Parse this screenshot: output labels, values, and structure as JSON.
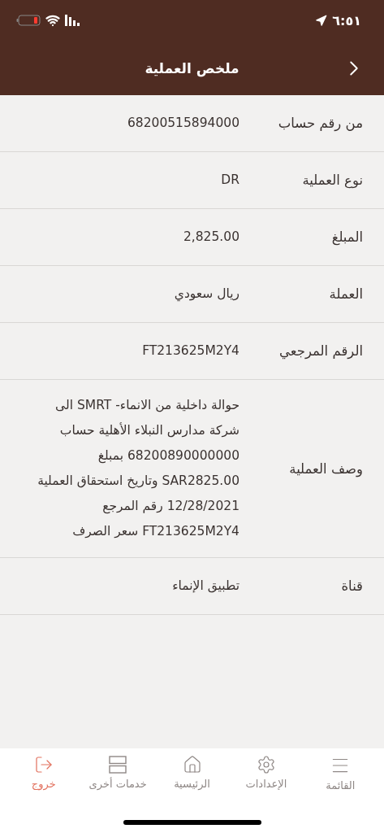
{
  "status_bar": {
    "time": "٦:٥١"
  },
  "header": {
    "title": "ملخص العملية"
  },
  "details": [
    {
      "label": "من رقم حساب",
      "value": "68200515894000"
    },
    {
      "label": "نوع العملية",
      "value": "DR"
    },
    {
      "label": "المبلغ",
      "value": "2,825.00"
    },
    {
      "label": "العملة",
      "value": "ريال سعودي"
    },
    {
      "label": "الرقم المرجعي",
      "value": "FT213625M2Y4"
    },
    {
      "label": "وصف العملية",
      "value": "حوالة داخلية من الانماء- SMRT الى\nشركة مدارس النبلاء الأهلية حساب\n68200890000000 بمبلغ\nSAR2825.00 وتاريخ استحقاق العملية\n12/28/2021 رقم المرجع\nFT213625M2Y4 سعر الصرف"
    },
    {
      "label": "قناة",
      "value": "تطبيق الإنماء"
    }
  ],
  "tab_bar": [
    {
      "kind": "menu",
      "label": "القائمة"
    },
    {
      "kind": "settings",
      "label": "الإعدادات"
    },
    {
      "kind": "home",
      "label": "الرئيسية"
    },
    {
      "kind": "services",
      "label": "خدمات أخرى"
    },
    {
      "kind": "logout",
      "label": "خروج"
    }
  ]
}
